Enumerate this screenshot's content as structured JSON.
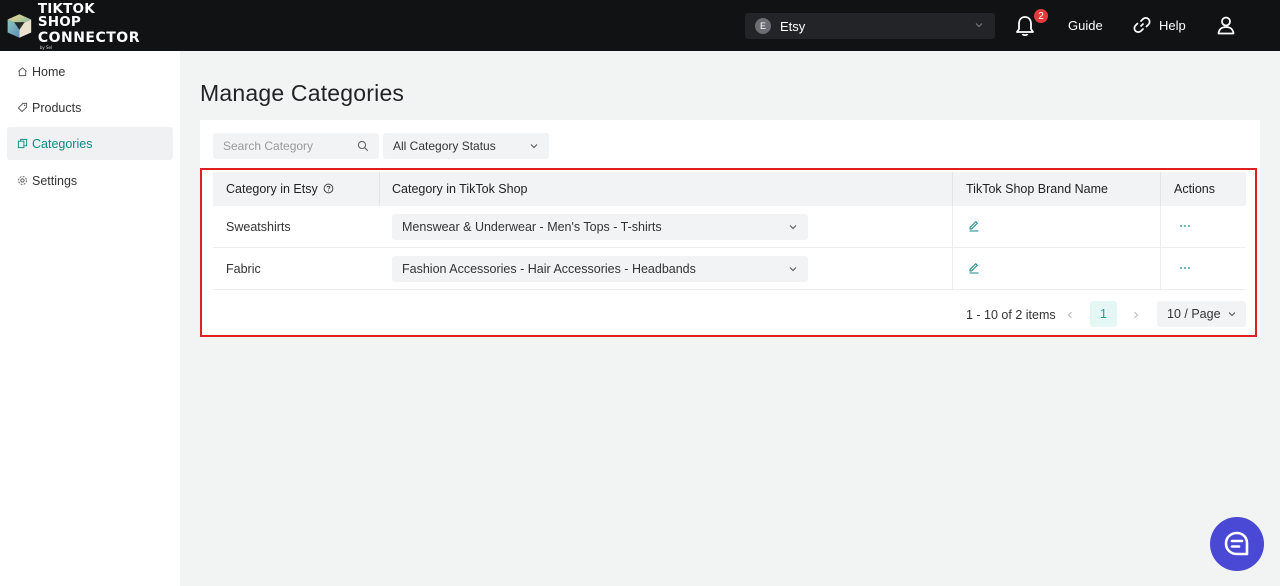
{
  "header": {
    "logo_line1": "TIKTOK SHOP",
    "logo_line2": "CONNECTOR",
    "logo_by": "by Sel",
    "store_avatar": "E",
    "store_name": "Etsy",
    "notification_count": "2",
    "guide_label": "Guide",
    "help_label": "Help"
  },
  "sidebar": {
    "items": [
      {
        "label": "Home",
        "icon": "home-icon"
      },
      {
        "label": "Products",
        "icon": "tag-icon"
      },
      {
        "label": "Categories",
        "icon": "copy-icon"
      },
      {
        "label": "Settings",
        "icon": "gear-icon"
      }
    ],
    "active": "Categories"
  },
  "main": {
    "title": "Manage Categories",
    "search_placeholder": "Search Category",
    "status_filter": "All Category Status",
    "table": {
      "headers": [
        "Category in Etsy",
        "Category in TikTok Shop",
        "TikTok Shop Brand Name",
        "Actions"
      ],
      "rows": [
        {
          "etsy": "Sweatshirts",
          "tiktok": "Menswear & Underwear - Men's Tops - T-shirts"
        },
        {
          "etsy": "Fabric",
          "tiktok": "Fashion Accessories - Hair Accessories - Headbands"
        }
      ]
    },
    "pagination": {
      "summary": "1 - 10 of 2 items",
      "current_page": "1",
      "page_size": "10",
      "page_size_suffix": " / Page"
    }
  },
  "colors": {
    "accent": "#0f8a86",
    "header_bg": "#111214",
    "highlight": "#e02020",
    "chat": "#4949d6",
    "badge": "#e33b3b"
  }
}
